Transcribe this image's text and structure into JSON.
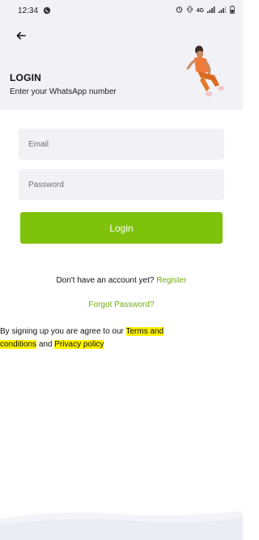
{
  "status_bar": {
    "time": "12:34",
    "network_label": "4G",
    "icons": [
      "whatsapp-icon",
      "alarm-icon",
      "vibrate-icon",
      "signal-icon",
      "battery-icon"
    ]
  },
  "header": {
    "back_icon": "arrow-left-icon",
    "title": "LOGIN",
    "subtitle": "Enter your WhatsApp number"
  },
  "form": {
    "email_placeholder": "Email",
    "email_value": "",
    "password_placeholder": "Password",
    "password_value": "",
    "login_label": "Login"
  },
  "register": {
    "prompt": "Don't have an account yet?",
    "link": "Register"
  },
  "forgot_password": "Forgot Password?",
  "terms": {
    "prefix": "By signing up you are agree to our",
    "terms_link": "Terms and conditions",
    "conjunction": "and",
    "privacy_link": "Privacy policy"
  },
  "colors": {
    "accent": "#7ec20b",
    "link": "#6fae0c",
    "highlight": "#fff200",
    "surface": "#f1f1f6"
  }
}
